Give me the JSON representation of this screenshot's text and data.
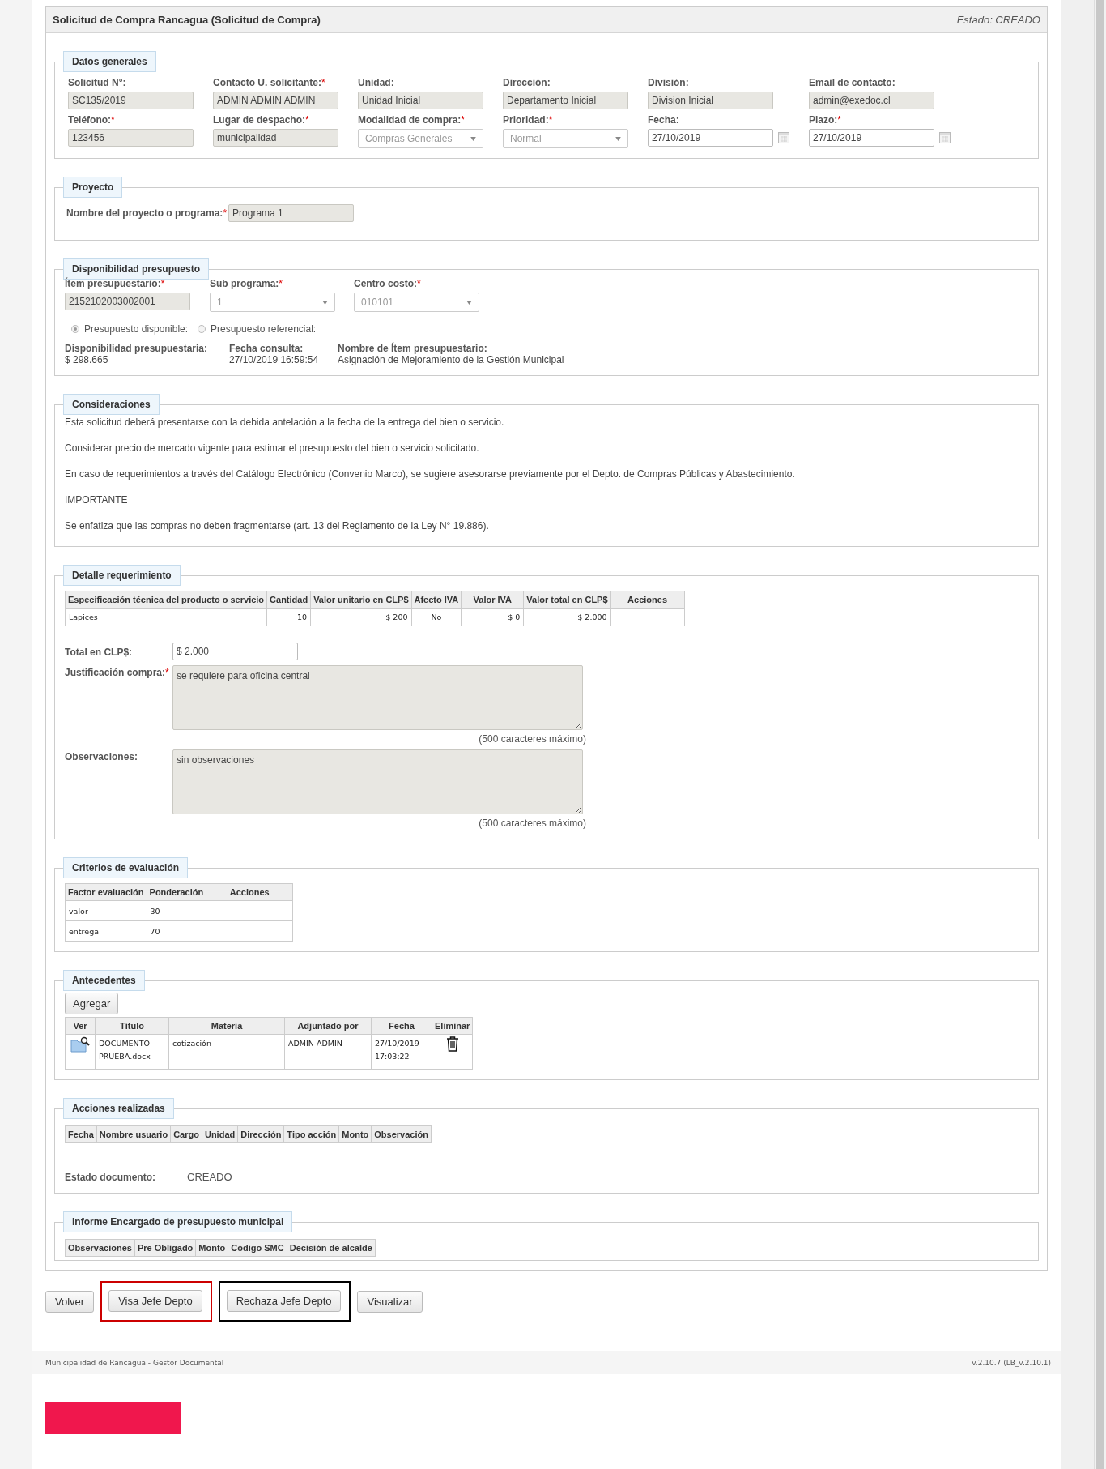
{
  "header": {
    "title": "Solicitud de Compra Rancagua (Solicitud de Compra)",
    "status": "Estado: CREADO"
  },
  "datos_generales": {
    "title": "Datos generales",
    "fields": [
      {
        "label": "Solicitud N°:",
        "kind": "text",
        "readonly": true,
        "value": "SC135/2019"
      },
      {
        "label": "Contacto U. solicitante:",
        "mark": "*",
        "kind": "text",
        "readonly": true,
        "value": "ADMIN ADMIN ADMIN"
      },
      {
        "label": "Unidad:",
        "kind": "text",
        "readonly": true,
        "value": "Unidad Inicial"
      },
      {
        "label": "Dirección:",
        "kind": "text",
        "readonly": true,
        "value": "Departamento Inicial"
      },
      {
        "label": "División:",
        "kind": "text",
        "readonly": true,
        "value": "Division Inicial"
      },
      {
        "label": "Email de contacto:",
        "kind": "text",
        "readonly": true,
        "value": "admin@exedoc.cl"
      },
      {
        "label": "Teléfono:",
        "mark": "*",
        "kind": "text",
        "readonly": true,
        "value": "123456"
      },
      {
        "label": "Lugar de despacho:",
        "mark": "*",
        "kind": "text",
        "readonly": true,
        "value": "municipalidad"
      },
      {
        "label": "Modalidad de compra:",
        "mark": "*",
        "kind": "select",
        "disabled": true,
        "value": "Compras Generales"
      },
      {
        "label": "Prioridad:",
        "mark": "*",
        "kind": "select",
        "disabled": true,
        "value": "Normal"
      },
      {
        "label": "Fecha:",
        "kind": "date",
        "readonly": false,
        "value": "27/10/2019"
      },
      {
        "label": "Plazo:",
        "mark": "*",
        "kind": "date",
        "readonly": false,
        "value": "27/10/2019"
      }
    ]
  },
  "proyecto": {
    "title": "Proyecto",
    "label": "Nombre del proyecto o programa:",
    "mark": "*",
    "value": "Programa 1",
    "readonly": true
  },
  "presupuesto": {
    "title": "Disponibilidad presupuesto",
    "fields": [
      {
        "label": "Ítem presupuestario:",
        "mark": "*",
        "kind": "text",
        "readonly": true,
        "value": "2152102003002001"
      },
      {
        "label": "Sub programa:",
        "mark": "*",
        "kind": "select",
        "disabled": true,
        "value": "1"
      },
      {
        "label": "Centro costo:",
        "mark": "*",
        "kind": "select",
        "disabled": true,
        "value": "010101"
      }
    ],
    "radios": [
      {
        "label": "Presupuesto disponible:",
        "selected": true
      },
      {
        "label": "Presupuesto referencial:",
        "selected": false
      }
    ],
    "info": [
      {
        "label": "Disponibilidad presupuestaria:",
        "value": "$ 298.665"
      },
      {
        "label": "Fecha consulta:",
        "value": "27/10/2019 16:59:54"
      },
      {
        "label": "Nombre de Ítem presupuestario:",
        "value": "Asignación de Mejoramiento de la Gestión Municipal"
      }
    ]
  },
  "consideraciones": {
    "title": "Consideraciones",
    "paragraphs": [
      "Esta solicitud deberá presentarse con la debida antelación a la fecha de la entrega del bien o servicio.",
      "Considerar precio de mercado vigente para estimar el presupuesto del bien o servicio solicitado.",
      "En caso de requerimientos a través del Catálogo Electrónico (Convenio Marco), se sugiere asesorarse previamente por el Depto. de Compras Públicas y Abastecimiento.",
      "IMPORTANTE",
      "Se enfatiza que las compras no deben fragmentarse (art. 13 del Reglamento de la Ley N° 19.886)."
    ]
  },
  "detalle": {
    "title": "Detalle requerimiento",
    "columns": [
      "Especificación técnica del producto o servicio",
      "Cantidad",
      "Valor unitario en CLP$",
      "Afecto IVA",
      "Valor IVA",
      "Valor total en CLP$",
      "Acciones"
    ],
    "rows": [
      [
        "Lapices",
        "10",
        "$ 200",
        "No",
        "$ 0",
        "$ 2.000",
        ""
      ]
    ],
    "total": {
      "label": "Total en CLP$:",
      "value": "$ 2.000"
    },
    "justificacion": {
      "label": "Justificación compra:",
      "mark": "*",
      "value": "se requiere para oficina central",
      "hint": "(500 caracteres máximo)"
    },
    "observaciones": {
      "label": "Observaciones:",
      "value": "sin observaciones",
      "hint": "(500 caracteres máximo)"
    }
  },
  "criterios": {
    "title": "Criterios de evaluación",
    "columns": [
      "Factor evaluación",
      "Ponderación",
      "Acciones"
    ],
    "rows": [
      [
        "valor",
        "30",
        ""
      ],
      [
        "entrega",
        "70",
        ""
      ]
    ]
  },
  "antecedentes": {
    "title": "Antecedentes",
    "add_button": "Agregar",
    "columns": [
      "Ver",
      "Título",
      "Materia",
      "Adjuntado por",
      "Fecha",
      "Eliminar"
    ],
    "rows": [
      {
        "titulo": "DOCUMENTO PRUEBA.docx",
        "materia": "cotización",
        "adjuntado_por": "ADMIN ADMIN",
        "fecha": "27/10/2019 17:03:22"
      }
    ]
  },
  "acciones": {
    "title": "Acciones realizadas",
    "columns": [
      "Fecha",
      "Nombre usuario",
      "Cargo",
      "Unidad",
      "Dirección",
      "Tipo acción",
      "Monto",
      "Observación"
    ],
    "estado_label": "Estado documento:",
    "estado_value": "CREADO"
  },
  "informe": {
    "title": "Informe Encargado de presupuesto municipal",
    "columns": [
      "Observaciones",
      "Pre Obligado",
      "Monto",
      "Código SMC",
      "Decisión de alcalde"
    ]
  },
  "buttons": [
    {
      "label": "Volver"
    },
    {
      "label": "Visa Jefe Depto",
      "color": "#cc0000"
    },
    {
      "label": "Rechaza Jefe Depto",
      "color": "#000000"
    },
    {
      "label": "Visualizar"
    }
  ],
  "footer": {
    "left": "Municipalidad de Rancagua - Gestor Documental",
    "right": "v.2.10.7 (LB_v.2.10.1)"
  }
}
